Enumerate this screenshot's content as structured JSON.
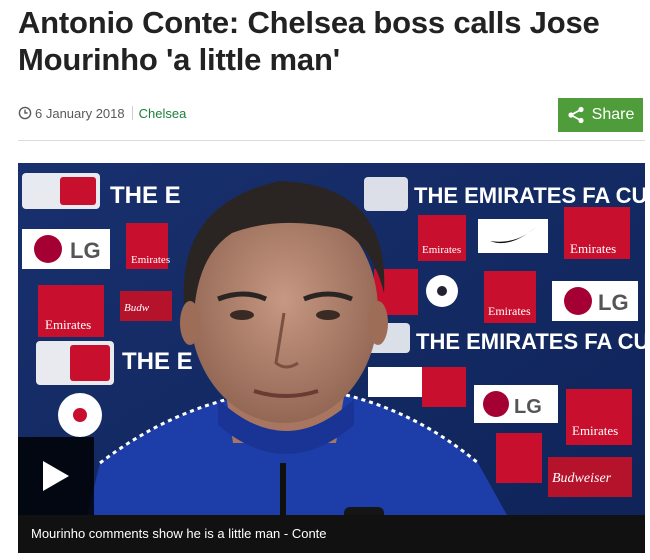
{
  "article": {
    "headline": "Antonio Conte: Chelsea boss calls Jose Mourinho 'a little man'",
    "date": "6 January 2018",
    "category": "Chelsea"
  },
  "share": {
    "label": "Share",
    "icon": "share-icon"
  },
  "video": {
    "caption": "Mourinho comments show he is a little man - Conte",
    "backdrop_text": "THE EMIRATES FA CUP",
    "backdrop_text_short": "THE E",
    "sponsor_emirates": "Emirates",
    "sponsor_lg": "LG",
    "sponsor_budweiser": "Budweiser"
  },
  "colors": {
    "accent_green": "#4f9d3a",
    "category_link": "#1d7e3a",
    "backdrop_blue": "#16296a",
    "emirates_red": "#c8102e"
  }
}
